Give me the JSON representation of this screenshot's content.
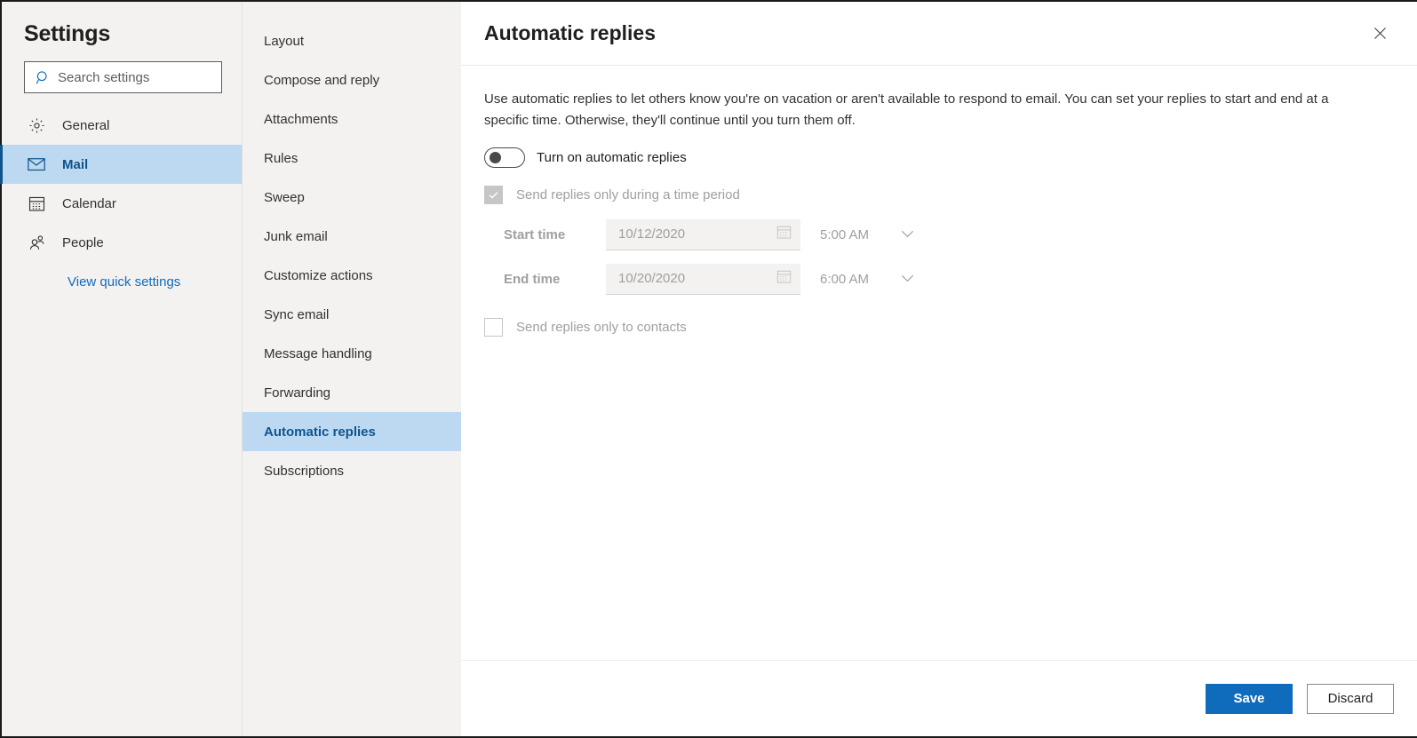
{
  "settings_panel": {
    "title": "Settings",
    "search": {
      "placeholder": "Search settings",
      "value": "",
      "icon": "search-icon"
    },
    "nav_items": [
      {
        "label": "General",
        "icon": "gear-icon",
        "selected": false
      },
      {
        "label": "Mail",
        "icon": "envelope-icon",
        "selected": true
      },
      {
        "label": "Calendar",
        "icon": "calendar-icon",
        "selected": false
      },
      {
        "label": "People",
        "icon": "people-icon",
        "selected": false
      }
    ],
    "quick_settings_link": "View quick settings",
    "accent_color": "#0f6cbd",
    "selected_bg": "#bdd9f2",
    "panel_bg": "#f3f2f1"
  },
  "subnav": {
    "items": [
      {
        "label": "Layout",
        "selected": false
      },
      {
        "label": "Compose and reply",
        "selected": false
      },
      {
        "label": "Attachments",
        "selected": false
      },
      {
        "label": "Rules",
        "selected": false
      },
      {
        "label": "Sweep",
        "selected": false
      },
      {
        "label": "Junk email",
        "selected": false
      },
      {
        "label": "Customize actions",
        "selected": false
      },
      {
        "label": "Sync email",
        "selected": false
      },
      {
        "label": "Message handling",
        "selected": false
      },
      {
        "label": "Forwarding",
        "selected": false
      },
      {
        "label": "Automatic replies",
        "selected": true
      },
      {
        "label": "Subscriptions",
        "selected": false
      }
    ]
  },
  "detail": {
    "title": "Automatic replies",
    "close_icon": "close-icon",
    "description": "Use automatic replies to let others know you're on vacation or aren't available to respond to email. You can set your replies to start and end at a specific time. Otherwise, they'll continue until you turn them off.",
    "toggle": {
      "label": "Turn on automatic replies",
      "state": "off"
    },
    "time_period_checkbox": {
      "label": "Send replies only during a time period",
      "checked": true,
      "disabled": true
    },
    "start_time": {
      "label": "Start time",
      "date_value": "10/12/2020",
      "date_icon": "calendar-icon",
      "time_value": "5:00 AM",
      "time_icon": "chevron-down-icon"
    },
    "end_time": {
      "label": "End time",
      "date_value": "10/20/2020",
      "date_icon": "calendar-icon",
      "time_value": "6:00 AM",
      "time_icon": "chevron-down-icon"
    },
    "contacts_checkbox": {
      "label": "Send replies only to contacts",
      "checked": false,
      "disabled": true
    },
    "footer": {
      "save_label": "Save",
      "discard_label": "Discard",
      "primary_color": "#0f6cbd"
    }
  }
}
